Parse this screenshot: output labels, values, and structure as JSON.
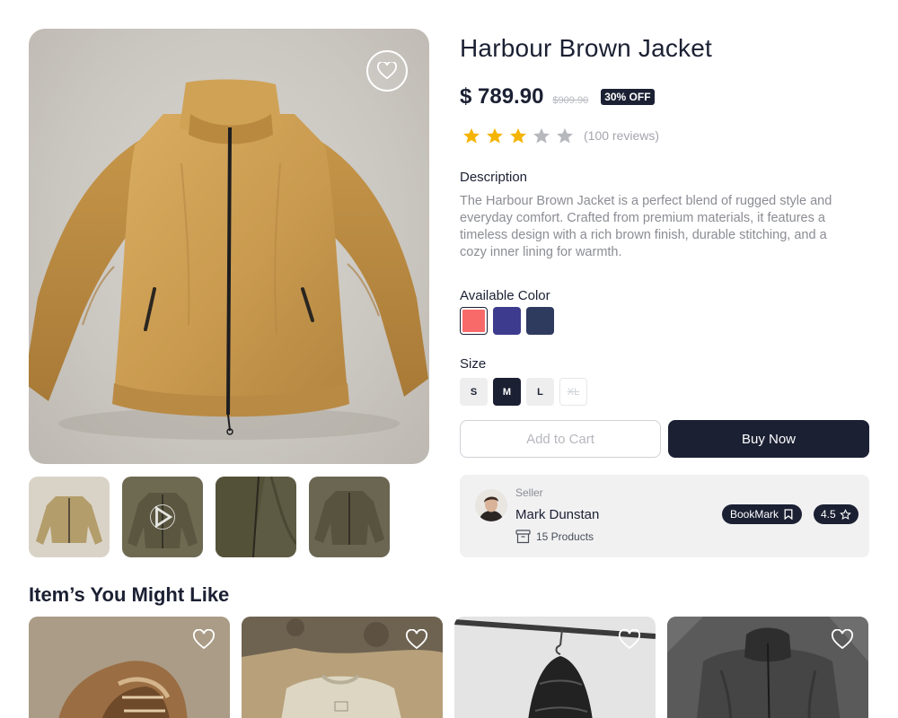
{
  "product": {
    "title": "Harbour Brown Jacket",
    "price": "$ 789.90",
    "old_price": "$909.90",
    "discount": "30% OFF",
    "rating": 3,
    "rating_max": 5,
    "reviews": "(100 reviews)",
    "description_label": "Description",
    "description": "The Harbour Brown Jacket is a perfect blend of rugged style and everyday comfort. Crafted from premium materials, it features a timeless design with a rich brown finish, durable stitching, and a cozy inner lining for warmth.",
    "color_label": "Available Color",
    "colors": [
      "#f86a6a",
      "#3d3b8e",
      "#2e3a5e"
    ],
    "selected_color": 0,
    "size_label": "Size",
    "sizes": [
      "S",
      "M",
      "L",
      "XL"
    ],
    "selected_size": "M",
    "unavailable_sizes": [
      "XL"
    ]
  },
  "actions": {
    "add_to_cart": "Add to Cart",
    "buy_now": "Buy Now"
  },
  "seller": {
    "role_label": "Seller",
    "name": "Mark Dunstan",
    "products": "15 Products",
    "bookmark_label": "BookMark",
    "rating": "4.5"
  },
  "gallery": {
    "thumbnails": [
      "jacket-front",
      "jacket-video",
      "jacket-detail",
      "jacket-back"
    ]
  },
  "recommendations": {
    "title": "Item’s You Might Like",
    "items": [
      "brown-leather-sneaker",
      "cream-sweatshirt",
      "black-puffer-jacket",
      "grey-fleece-jacket"
    ]
  },
  "colors": {
    "primary": "#1b2033",
    "star_filled": "#f5b400",
    "star_empty": "#b6b8be",
    "jacket": "#c99d52"
  }
}
